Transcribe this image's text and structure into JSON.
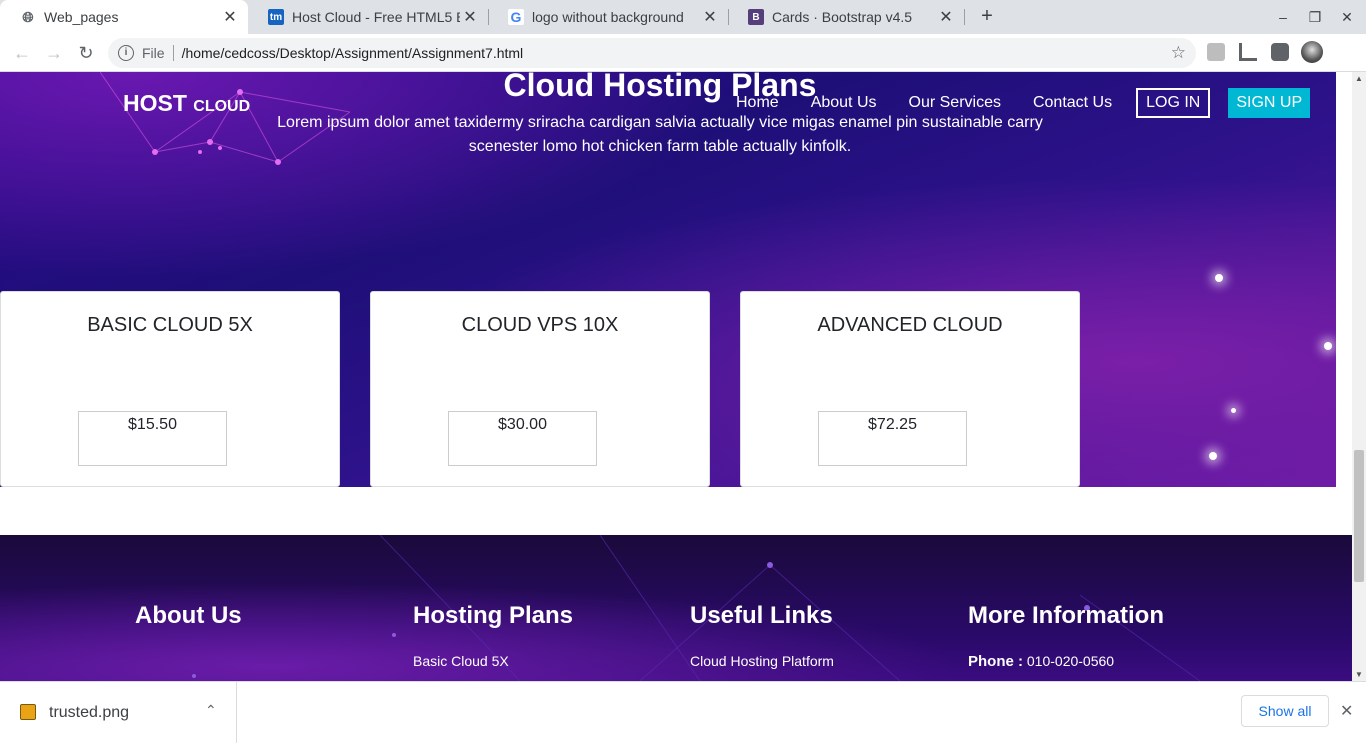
{
  "browser": {
    "tabs": [
      {
        "title": "Web_pages",
        "icon": "globe-icon",
        "active": true
      },
      {
        "title": "Host Cloud - Free HTML5 B",
        "icon": "tm",
        "active": false
      },
      {
        "title": "logo without background",
        "icon": "G",
        "active": false
      },
      {
        "title": "Cards · Bootstrap v4.5",
        "icon": "B",
        "active": false
      }
    ],
    "new_tab": "+",
    "window_controls": {
      "minimize": "–",
      "restore": "❐",
      "close": "✕"
    },
    "nav": {
      "back": "←",
      "forward": "→",
      "reload": "↻"
    },
    "omnibox": {
      "scheme_label": "File",
      "url": "/home/cedcoss/Desktop/Assignment/Assignment7.html",
      "star": "☆"
    }
  },
  "site": {
    "logo_main": "HOST",
    "logo_sub": "CLOUD",
    "nav": [
      "Home",
      "About Us",
      "Our Services",
      "Contact Us"
    ],
    "login": "LOG IN",
    "signup": "SIGN UP",
    "section_title": "Cloud Hosting Plans",
    "section_subtitle": "Lorem ipsum dolor amet taxidermy sriracha cardigan salvia actually vice migas enamel pin sustainable carry scenester lomo hot chicken farm table actually kinfolk.",
    "plans": [
      {
        "name": "BASIC CLOUD 5X",
        "price": "$15.50"
      },
      {
        "name": "CLOUD VPS 10X",
        "price": "$30.00"
      },
      {
        "name": "ADVANCED CLOUD",
        "price": "$72.25"
      }
    ],
    "footer": {
      "columns": [
        {
          "title": "About Us",
          "link": ""
        },
        {
          "title": "Hosting Plans",
          "link": "Basic Cloud 5X"
        },
        {
          "title": "Useful Links",
          "link": "Cloud Hosting Platform"
        },
        {
          "title": "More Information",
          "link_label": "Phone :",
          "link": "010-020-0560"
        }
      ]
    }
  },
  "downloads": {
    "file_name": "trusted.png",
    "chevron": "⌃",
    "show_all": "Show all",
    "close": "✕"
  }
}
